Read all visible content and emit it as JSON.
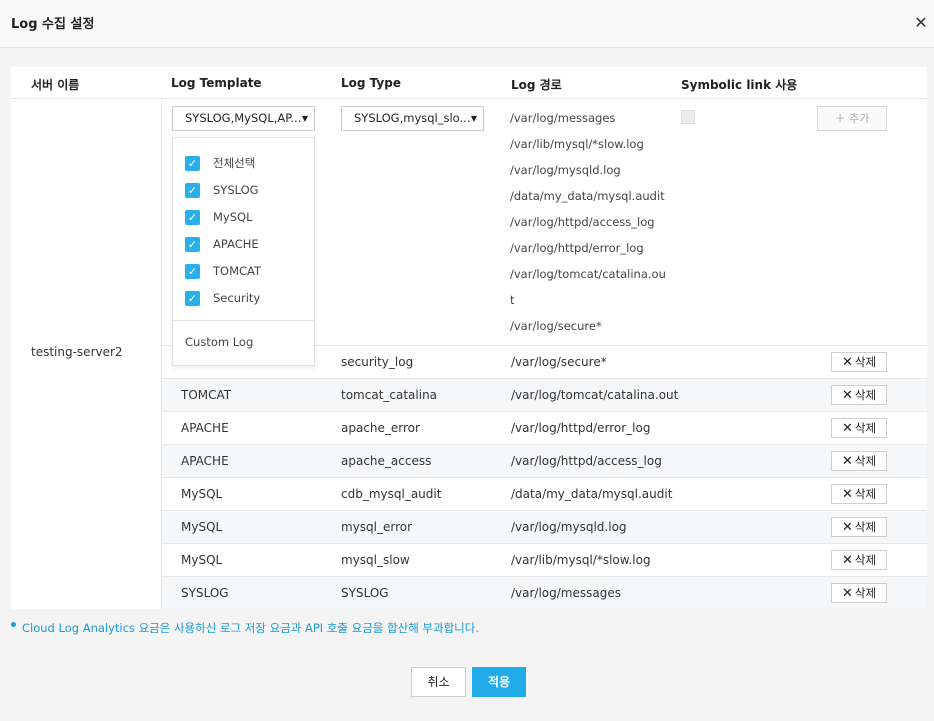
{
  "modal": {
    "title": "Log 수집 설정"
  },
  "headers": [
    "서버 이름",
    "Log Template",
    "Log Type",
    "Log 경로",
    "Symbolic link 사용"
  ],
  "server_name": "testing-server2",
  "edit_row": {
    "template_select": "SYSLOG,MySQL,AP...",
    "type_select": "SYSLOG,mysql_slo...",
    "paths": [
      "/var/log/messages",
      "/var/lib/mysql/*slow.log",
      "/var/log/mysqld.log",
      "/data/my_data/mysql.audit",
      "/var/log/httpd/access_log",
      "/var/log/httpd/error_log",
      "/var/log/tomcat/catalina.ou",
      "t",
      "/var/log/secure*"
    ],
    "add_label": "추가",
    "add_icon": "plus-icon"
  },
  "dropdown": {
    "items": [
      {
        "label": "전체선택",
        "checked": true
      },
      {
        "label": "SYSLOG",
        "checked": true
      },
      {
        "label": "MySQL",
        "checked": true
      },
      {
        "label": "APACHE",
        "checked": true
      },
      {
        "label": "TOMCAT",
        "checked": true
      },
      {
        "label": "Security",
        "checked": true
      }
    ],
    "custom_label": "Custom Log"
  },
  "rows": [
    {
      "template": "",
      "type": "security_log",
      "path": "/var/log/secure*",
      "action": "삭제"
    },
    {
      "template": "TOMCAT",
      "type": "tomcat_catalina",
      "path": "/var/log/tomcat/catalina.out",
      "action": "삭제"
    },
    {
      "template": "APACHE",
      "type": "apache_error",
      "path": "/var/log/httpd/error_log",
      "action": "삭제"
    },
    {
      "template": "APACHE",
      "type": "apache_access",
      "path": "/var/log/httpd/access_log",
      "action": "삭제"
    },
    {
      "template": "MySQL",
      "type": "cdb_mysql_audit",
      "path": "/data/my_data/mysql.audit",
      "action": "삭제"
    },
    {
      "template": "MySQL",
      "type": "mysql_error",
      "path": "/var/log/mysqld.log",
      "action": "삭제"
    },
    {
      "template": "MySQL",
      "type": "mysql_slow",
      "path": "/var/lib/mysql/*slow.log",
      "action": "삭제"
    },
    {
      "template": "SYSLOG",
      "type": "SYSLOG",
      "path": "/var/log/messages",
      "action": "삭제"
    }
  ],
  "note": "Cloud Log Analytics 요금은 사용하신 로그 저장 요금과 API 호출 요금을 합산해 부과합니다.",
  "buttons": {
    "cancel": "취소",
    "apply": "적용"
  },
  "colors": {
    "accent": "#22abe9",
    "note": "#1a9ad6"
  }
}
